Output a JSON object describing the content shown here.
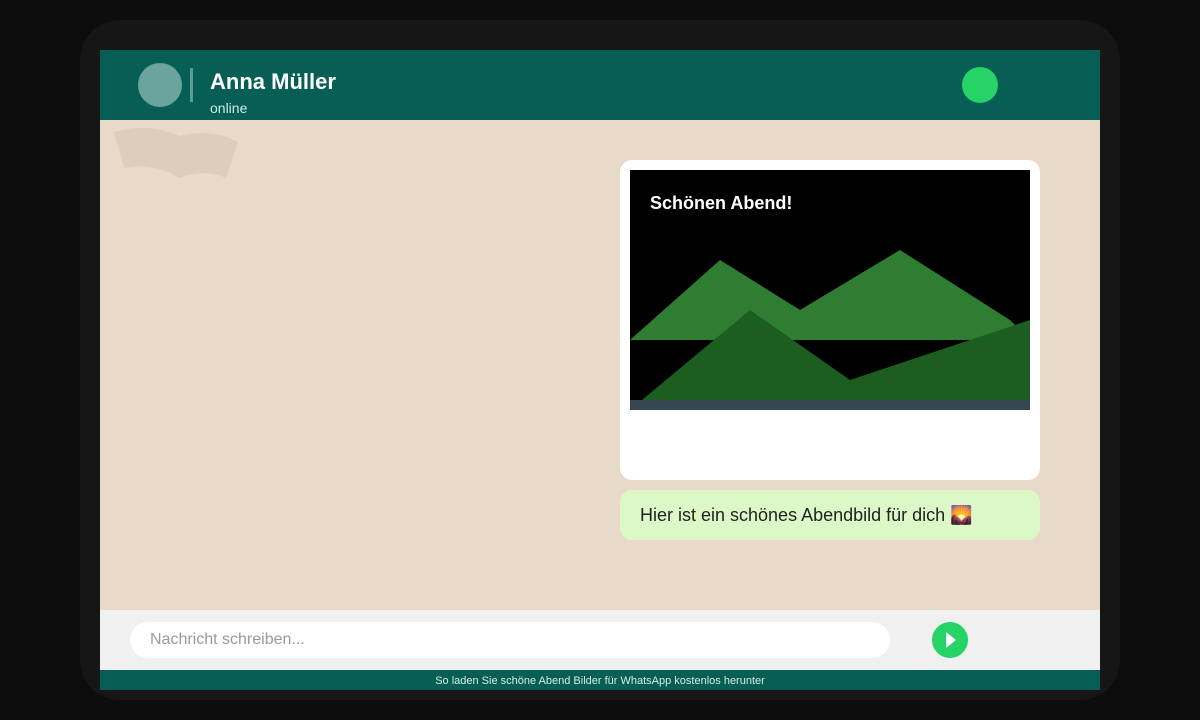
{
  "header": {
    "contact_name": "Anna Müller",
    "status": "online",
    "avatar_color": "#6aa49c",
    "call_button_color": "#25d366",
    "background_color": "#075e54"
  },
  "chat": {
    "wallpaper_color": "#e8d9c9",
    "image_message": {
      "caption": "Schönen Abend!",
      "image_description_icon": "landscape-mountains-icon"
    },
    "text_message": {
      "text": "Hier ist ein schönes Abendbild für dich 🌄",
      "bubble_color": "#dcf8c6"
    }
  },
  "composer": {
    "placeholder": "Nachricht schreiben...",
    "send_icon": "send-icon",
    "send_button_color": "#25d366"
  },
  "footer": {
    "text": "So laden Sie schöne Abend Bilder für WhatsApp kostenlos herunter"
  }
}
